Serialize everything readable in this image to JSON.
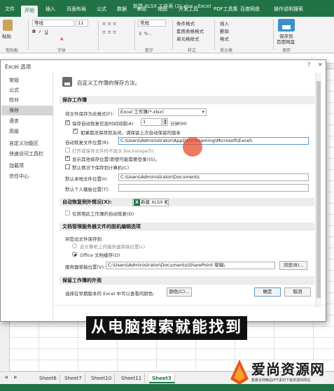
{
  "ribbon": {
    "tabs": [
      "文件",
      "开始",
      "插入",
      "页面布局",
      "公式",
      "数据",
      "审阅",
      "视图",
      "开发工具",
      "PDF工具集",
      "百度网盘",
      "操作说明搜索"
    ],
    "doc_title": "新建 XLSX 工作表 (2).xlsx - Excel",
    "paste": "粘贴",
    "clipboard": "剪贴板",
    "font_name": "等线",
    "font_size": "11",
    "font_group": "字体",
    "number_format": "常规",
    "number_group": "数字",
    "cond_format": "条件格式",
    "table_format": "套用表格格式",
    "cell_styles": "单元格样式",
    "styles_group": "样式",
    "insert": "插入",
    "delete": "删除",
    "format": "格式",
    "cells_group": "单元格",
    "save_to": "保存到",
    "baidu_pan": "百度网盘",
    "save_group": "保存"
  },
  "dialog": {
    "title": "Excel 选项",
    "nav": [
      "常规",
      "公式",
      "校对",
      "保存",
      "语言",
      "高级",
      "自定义功能区",
      "快速访问工具栏",
      "加载项",
      "信任中心"
    ],
    "active_nav": "保存",
    "header": "自定义工作簿的保存方法。",
    "sec_save": "保存工作簿",
    "format_label": "将文件保存为此格式(F):",
    "format_value": "Excel 工作簿(*.xlsx)",
    "autorecover_label": "保存自动恢复信息时间间隔(A)",
    "autorecover_value": "1",
    "minutes": "分钟(M)",
    "keep_last": "如果我没保存就关闭，请保留上次自动保留的版本",
    "autorecover_loc_label": "自动恢复文件位置(R):",
    "autorecover_loc_value": "C:\\Users\\Administrator\\AppData\\Roaming\\Microsoft\\Excel\\",
    "no_backstage": "打开或保存文件时不显示 Backstage(S)",
    "show_other": "显示其他保存位置(即使可能需要登录)(S)。",
    "default_local": "默认情况下保存到计算机(C)",
    "local_default_label": "默认本地文件位置(I):",
    "local_default_value": "C:\\Users\\Administrator\\Documents",
    "template_label": "默认个人模板位置(T):",
    "template_value": "",
    "sec_exceptions": "自动恢复例外情况(X):",
    "exceptions_file": "新建 XLSX 工作...",
    "disable_autorecover": "仅禁用此工作簿的自动恢复(D)",
    "sec_offline": "文档管理服务器文件的脱机编辑选项",
    "checkout_label": "将签出文件保存到:",
    "radio_server": "此计算机上的服务器草稿位置(L)",
    "radio_office_cache": "Office 文档缓存(O)",
    "drafts_label": "服务器草稿位置(V):",
    "drafts_value": "C:\\Users\\Administrator\\Documents\\SharePoint 草稿\\",
    "browse": "浏览(B)...",
    "sec_visual": "保留工作簿的外观",
    "colors_label": "选择在早期版本的 Excel 中可以查看的颜色:",
    "colors_btn": "颜色(C)...",
    "ok": "确定",
    "cancel": "取消"
  },
  "sheets": [
    "Sheet6",
    "Sheet7",
    "Sheet10",
    "Sheet11",
    "Sheet3"
  ],
  "active_sheet": "Sheet3",
  "caption": "从电脑搜索就能找到",
  "watermark": {
    "name": "爱尚资源网",
    "sub": "集聚全网精品PPT素材下载资源的网站"
  },
  "colors": {
    "excel_green": "#217346",
    "cursor": "#e84628"
  }
}
